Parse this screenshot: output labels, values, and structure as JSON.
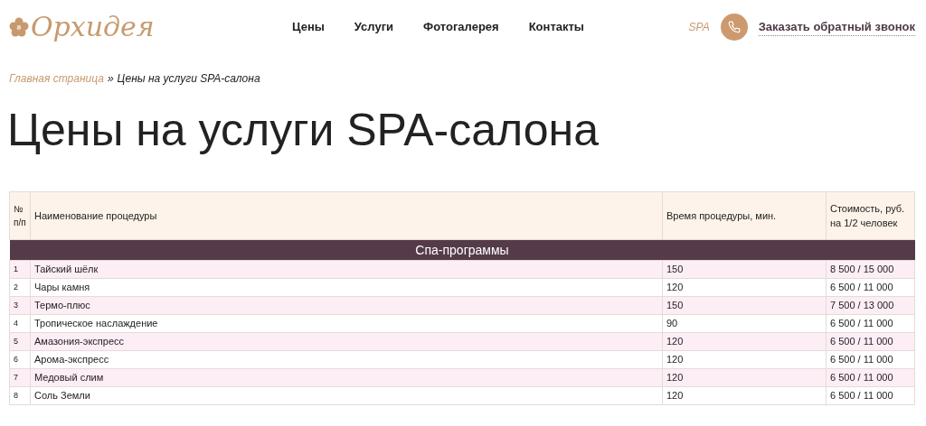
{
  "header": {
    "logo": "Орхидея",
    "nav": [
      "Цены",
      "Услуги",
      "Фотогалерея",
      "Контакты"
    ],
    "spa_link": "SPA",
    "callback": "Заказать обратный звонок"
  },
  "breadcrumbs": {
    "home": "Главная страница",
    "separator": "»",
    "current": "Цены на услуги SPA-салона"
  },
  "title": "Цены на услуги SPA-салона",
  "table": {
    "columns": [
      "№ п/п",
      "Наименование процедуры",
      "Время процедуры, мин.",
      "Стоимость, руб. на 1/2 человек"
    ],
    "group": "Спа-программы",
    "rows": [
      {
        "num": "1",
        "name": "Тайский шёлк",
        "time": "150",
        "price": "8 500 / 15 000"
      },
      {
        "num": "2",
        "name": "Чары камня",
        "time": "120",
        "price": "6 500 / 11 000"
      },
      {
        "num": "3",
        "name": "Термо-плюс",
        "time": "150",
        "price": "7 500 / 13 000"
      },
      {
        "num": "4",
        "name": "Тропическое наслаждение",
        "time": "90",
        "price": "6 500 / 11 000"
      },
      {
        "num": "5",
        "name": "Амазония-экспресс",
        "time": "120",
        "price": "6 500 / 11 000"
      },
      {
        "num": "6",
        "name": "Арома-экспресс",
        "time": "120",
        "price": "6 500 / 11 000"
      },
      {
        "num": "7",
        "name": "Медовый слим",
        "time": "120",
        "price": "6 500 / 11 000"
      },
      {
        "num": "8",
        "name": "Соль Земли",
        "time": "120",
        "price": "6 500 / 11 000"
      }
    ]
  }
}
